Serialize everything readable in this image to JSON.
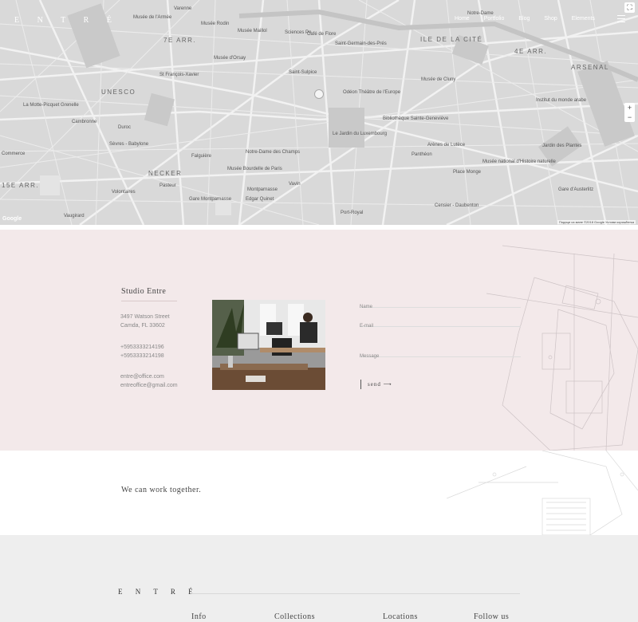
{
  "header": {
    "logo": "E N T R É",
    "nav": [
      "Home",
      "Portfolio",
      "Blog",
      "Shop",
      "Elements"
    ]
  },
  "map": {
    "labels": [
      "Varenne",
      "Musée de l'Armée",
      "Musée Rodin",
      "Musée Maillol",
      "Sciences Po",
      "Café de Flore",
      "Notre-Dame",
      "7E ARR.",
      "ILE DE LA CITÉ",
      "4E ARR.",
      "ARSENAL",
      "UNESCO",
      "St François-Xavier",
      "Musée d'Orsay",
      "Saint-Germain-des-Prés",
      "Saint-Sulpice",
      "Odéon Théâtre de l'Europe",
      "Musée de Cluny",
      "Panthéon",
      "Le Jardin du Luxembourg",
      "Montparnasse",
      "NECKER",
      "15E ARR.",
      "Cambronne",
      "Duroc",
      "Sèvres - Babylone",
      "Musée Bourdelle de Paris",
      "Gare Montparnasse",
      "Vavin",
      "Port-Royal",
      "Place Monge",
      "Jardin des Plantes",
      "Gare d'Austerlitz",
      "Censier - Daubenton",
      "Volontaires",
      "Vaugirard",
      "Musée national d'Histoire naturelle",
      "Institut du monde arabe",
      "Bibliothèque Sainte-Geneviève",
      "Arènes de Lutèce",
      "La Motte-Picquet Grenelle",
      "Commerce",
      "Edgar Quinet",
      "Notre-Dame des Champs",
      "Falguière",
      "Pasteur"
    ],
    "attribution": "Подаци са мапе ©2018 Google   Услови коришћења",
    "google": "Google",
    "zoom_in": "+",
    "zoom_out": "−",
    "fullscreen": "⛶"
  },
  "contact": {
    "studio_title": "Studio Entre",
    "address_line1": "3497 Watson Street",
    "address_line2": "Camda, FL 33602",
    "phone1": "+5953333214196",
    "phone2": "+5953333214198",
    "email1": "entre@office.com",
    "email2": "entreoffice@gmail.com",
    "form": {
      "name_placeholder": "Name",
      "email_placeholder": "E-mail",
      "message_placeholder": "Message",
      "send_label": "send ⟶"
    }
  },
  "tagline": "We can work together.",
  "footer": {
    "logo": "E N T R É",
    "columns": [
      "Info",
      "Collections",
      "Locations",
      "Follow us"
    ]
  },
  "colors": {
    "contact_bg": "#f3e9ea",
    "footer_bg": "#eeeeee",
    "map_bg": "#d9d9d9"
  }
}
